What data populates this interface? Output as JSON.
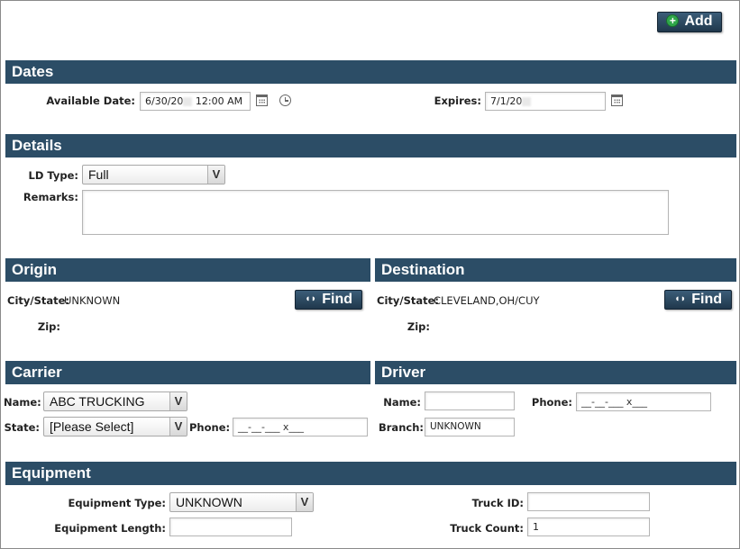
{
  "toolbar": {
    "add_label": "Add"
  },
  "dates": {
    "header": "Dates",
    "available_label": "Available Date:",
    "available_value": "6/30/20",
    "available_time": "12:00 AM",
    "expires_label": "Expires:",
    "expires_value": "7/1/20"
  },
  "details": {
    "header": "Details",
    "ld_type_label": "LD Type:",
    "ld_type_value": "Full",
    "remarks_label": "Remarks:"
  },
  "origin": {
    "header": "Origin",
    "city_state_label": "City/State:",
    "city_state_value": "UNKNOWN",
    "find_label": "Find",
    "zip_label": "Zip:"
  },
  "destination": {
    "header": "Destination",
    "city_state_label": "City/State:",
    "city_state_value": "CLEVELAND,OH/CUY",
    "find_label": "Find",
    "zip_label": "Zip:"
  },
  "carrier": {
    "header": "Carrier",
    "name_label": "Name:",
    "name_value": "ABC TRUCKING",
    "state_label": "State:",
    "state_value": "[Please Select]",
    "phone_label": "Phone:",
    "phone_value": "__-__-___ x___"
  },
  "driver": {
    "header": "Driver",
    "name_label": "Name:",
    "phone_label": "Phone:",
    "phone_value": "__-__-___ x___",
    "branch_label": "Branch:",
    "branch_value": "UNKNOWN"
  },
  "equipment": {
    "header": "Equipment",
    "type_label": "Equipment Type:",
    "type_value": "UNKNOWN",
    "length_label": "Equipment Length:",
    "truck_id_label": "Truck ID:",
    "truck_count_label": "Truck Count:",
    "truck_count_value": "1"
  },
  "icons": {
    "add": "plus-circle-icon",
    "calendar": "calendar-icon",
    "clock": "clock-icon",
    "find": "binoculars-icon",
    "dropdown": "chevron-down-icon"
  },
  "colors": {
    "header_bg": "#2c4d66",
    "button_bg": "#2a4a62",
    "add_icon": "#2fa64a"
  }
}
